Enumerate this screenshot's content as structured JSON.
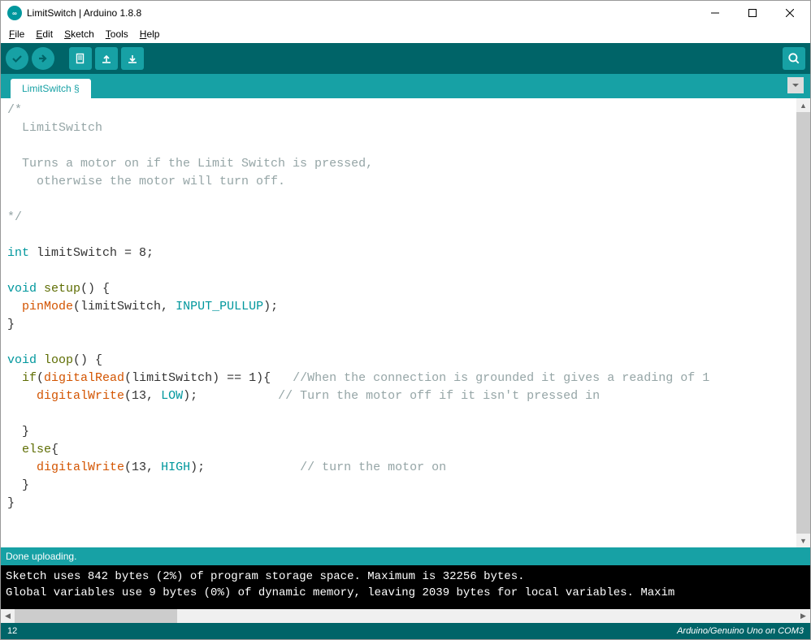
{
  "window": {
    "title": "LimitSwitch | Arduino 1.8.8"
  },
  "menu": {
    "file": "File",
    "edit": "Edit",
    "sketch": "Sketch",
    "tools": "Tools",
    "help": "Help"
  },
  "tab": {
    "name": "LimitSwitch §"
  },
  "code": {
    "l1": "/*",
    "l2": "  LimitSwitch",
    "l3": "",
    "l4": "  Turns a motor on if the Limit Switch is pressed,",
    "l5": "    otherwise the motor will turn off.",
    "l6": "",
    "l7": "*/",
    "l8a": "int",
    "l8b": " limitSwitch = 8;",
    "l9a": "void",
    "l9b": " ",
    "l9c": "setup",
    "l9d": "() {",
    "l10a": "  ",
    "l10b": "pinMode",
    "l10c": "(limitSwitch, ",
    "l10d": "INPUT_PULLUP",
    "l10e": ");",
    "l11": "}",
    "l12a": "void",
    "l12b": " ",
    "l12c": "loop",
    "l12d": "() {",
    "l13a": "  ",
    "l13b": "if",
    "l13c": "(",
    "l13d": "digitalRead",
    "l13e": "(limitSwitch) == 1){   ",
    "l13f": "//When the connection is grounded it gives a reading of 1",
    "l14a": "    ",
    "l14b": "digitalWrite",
    "l14c": "(13, ",
    "l14d": "LOW",
    "l14e": ");           ",
    "l14f": "// Turn the motor off if it isn't pressed in",
    "l15": "    ",
    "l16": "  }",
    "l17a": "  ",
    "l17b": "else",
    "l17c": "{",
    "l18a": "    ",
    "l18b": "digitalWrite",
    "l18c": "(13, ",
    "l18d": "HIGH",
    "l18e": ");             ",
    "l18f": "// turn the motor on",
    "l19": "  }",
    "l20": "}"
  },
  "status": {
    "message": "Done uploading."
  },
  "console": {
    "line1": "Sketch uses 842 bytes (2%) of program storage space. Maximum is 32256 bytes.",
    "line2": "Global variables use 9 bytes (0%) of dynamic memory, leaving 2039 bytes for local variables. Maxim"
  },
  "footer": {
    "line": "12",
    "board": "Arduino/Genuino Uno on COM3"
  }
}
